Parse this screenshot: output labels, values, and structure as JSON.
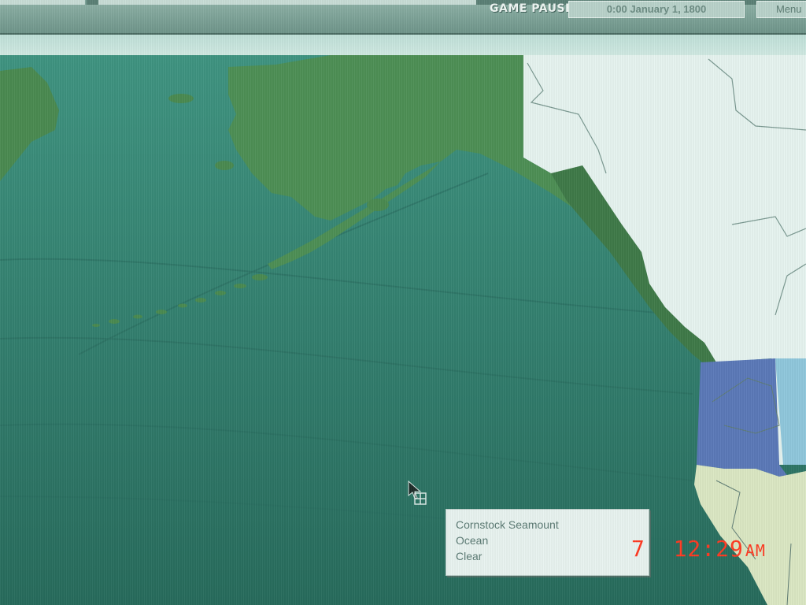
{
  "top_bar": {
    "status": "GAME PAUSED",
    "date": "0:00 January 1, 1800",
    "menu_label": "Menu"
  },
  "info_popup": {
    "lines": [
      "Cornstock Seamount",
      "Ocean",
      "Clear"
    ]
  },
  "camera_stamp": {
    "day": "7",
    "time": "12:29",
    "ampm": "AM"
  },
  "icons": {
    "cursor": "arrow-cursor-icon"
  },
  "colors": {
    "ocean": "#2f7a6a",
    "land_explored": "#4a8a50",
    "land_unexplored": "#e6f4f0",
    "region_blue": "#5b79b8",
    "region_lightblue": "#8fc7dc",
    "region_cream": "#dbe7c3",
    "stamp_red": "#ff3a22"
  }
}
